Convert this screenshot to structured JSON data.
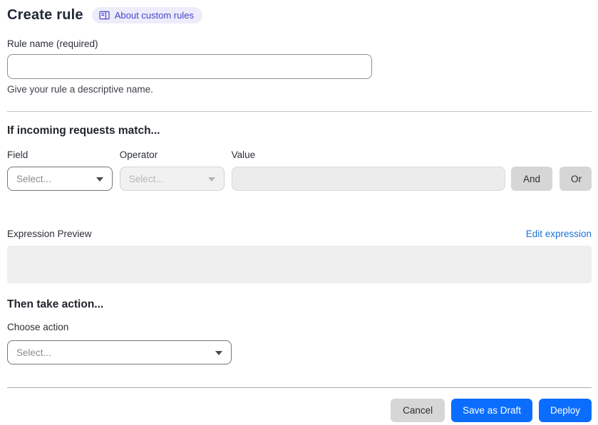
{
  "header": {
    "title": "Create rule",
    "badge": {
      "label": "About custom rules",
      "icon": "book-icon"
    }
  },
  "rule_name": {
    "label": "Rule name (required)",
    "value": "",
    "helper": "Give your rule a descriptive name."
  },
  "match_section": {
    "heading": "If incoming requests match...",
    "field": {
      "label": "Field",
      "selected": "Select...",
      "disabled": false,
      "icon": "chevron-down-icon"
    },
    "operator": {
      "label": "Operator",
      "selected": "Select...",
      "disabled": true,
      "icon": "chevron-down-icon"
    },
    "value": {
      "label": "Value",
      "value": "",
      "disabled": true
    },
    "and_button": "And",
    "or_button": "Or",
    "expression_preview_label": "Expression Preview",
    "edit_expression_link": "Edit expression",
    "expression_value": ""
  },
  "action_section": {
    "heading": "Then take action...",
    "choose_label": "Choose action",
    "select": {
      "selected": "Select...",
      "disabled": false,
      "icon": "chevron-down-icon"
    }
  },
  "footer": {
    "cancel": "Cancel",
    "save_draft": "Save as Draft",
    "deploy": "Deploy"
  },
  "colors": {
    "badge_bg": "#edecfb",
    "badge_text": "#4545cb",
    "primary_blue": "#0b6dfd",
    "link_blue": "#1d71d6",
    "gray_button": "#d6d6d6",
    "disabled_bg": "#f1f1f1",
    "value_disabled_bg": "#ececec",
    "preview_bg": "#efefef",
    "divider": "#c4c4c4"
  }
}
